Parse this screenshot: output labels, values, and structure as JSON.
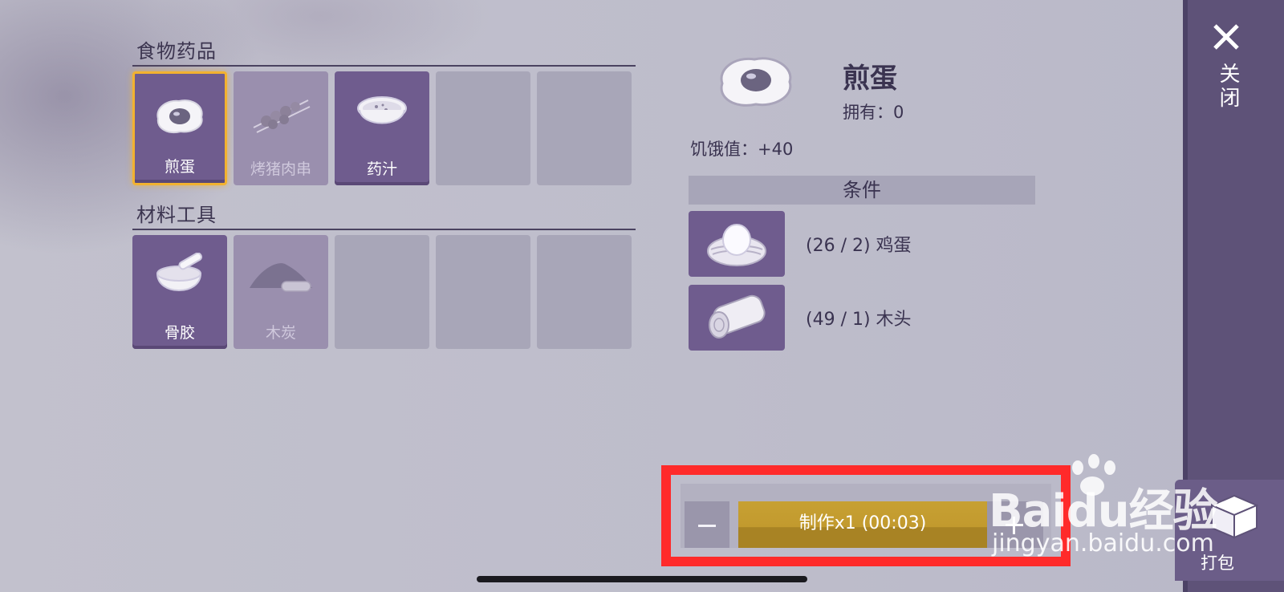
{
  "categories": [
    {
      "title": "食物药品",
      "slots": [
        {
          "label": "煎蛋",
          "state": "selected",
          "icon": "fried-egg-icon"
        },
        {
          "label": "烤猪肉串",
          "state": "faded",
          "icon": "meat-skewer-icon"
        },
        {
          "label": "药汁",
          "state": "filled",
          "icon": "potion-bowl-icon"
        },
        {
          "label": "",
          "state": "empty"
        },
        {
          "label": "",
          "state": "empty"
        }
      ]
    },
    {
      "title": "材料工具",
      "slots": [
        {
          "label": "骨胶",
          "state": "filled",
          "icon": "bone-glue-icon"
        },
        {
          "label": "木炭",
          "state": "faded",
          "icon": "charcoal-icon"
        },
        {
          "label": "",
          "state": "empty"
        },
        {
          "label": "",
          "state": "empty"
        },
        {
          "label": "",
          "state": "empty"
        }
      ]
    }
  ],
  "detail": {
    "name": "煎蛋",
    "owned": "拥有：0",
    "stat": "饥饿值：+40",
    "conditions_title": "条件",
    "requirements": [
      {
        "text": "(26 / 2) 鸡蛋",
        "icon": "egg-nest-icon"
      },
      {
        "text": "(49 / 1) 木头",
        "icon": "wood-log-icon"
      }
    ]
  },
  "sidebar": {
    "close_label": "关闭",
    "pack_label": "打包"
  },
  "craft": {
    "minus_label": "—",
    "button_label": "制作x1 (00:03)",
    "plus_label": "+"
  },
  "watermark": {
    "brand": "Baidu经验",
    "site": "jingyan.baidu.com"
  },
  "colors": {
    "accent_selected": "#f2b230",
    "craft_button": "#c29a2e",
    "highlight_box": "#ff2a2a",
    "slot_filled": "#6f5c8e"
  }
}
